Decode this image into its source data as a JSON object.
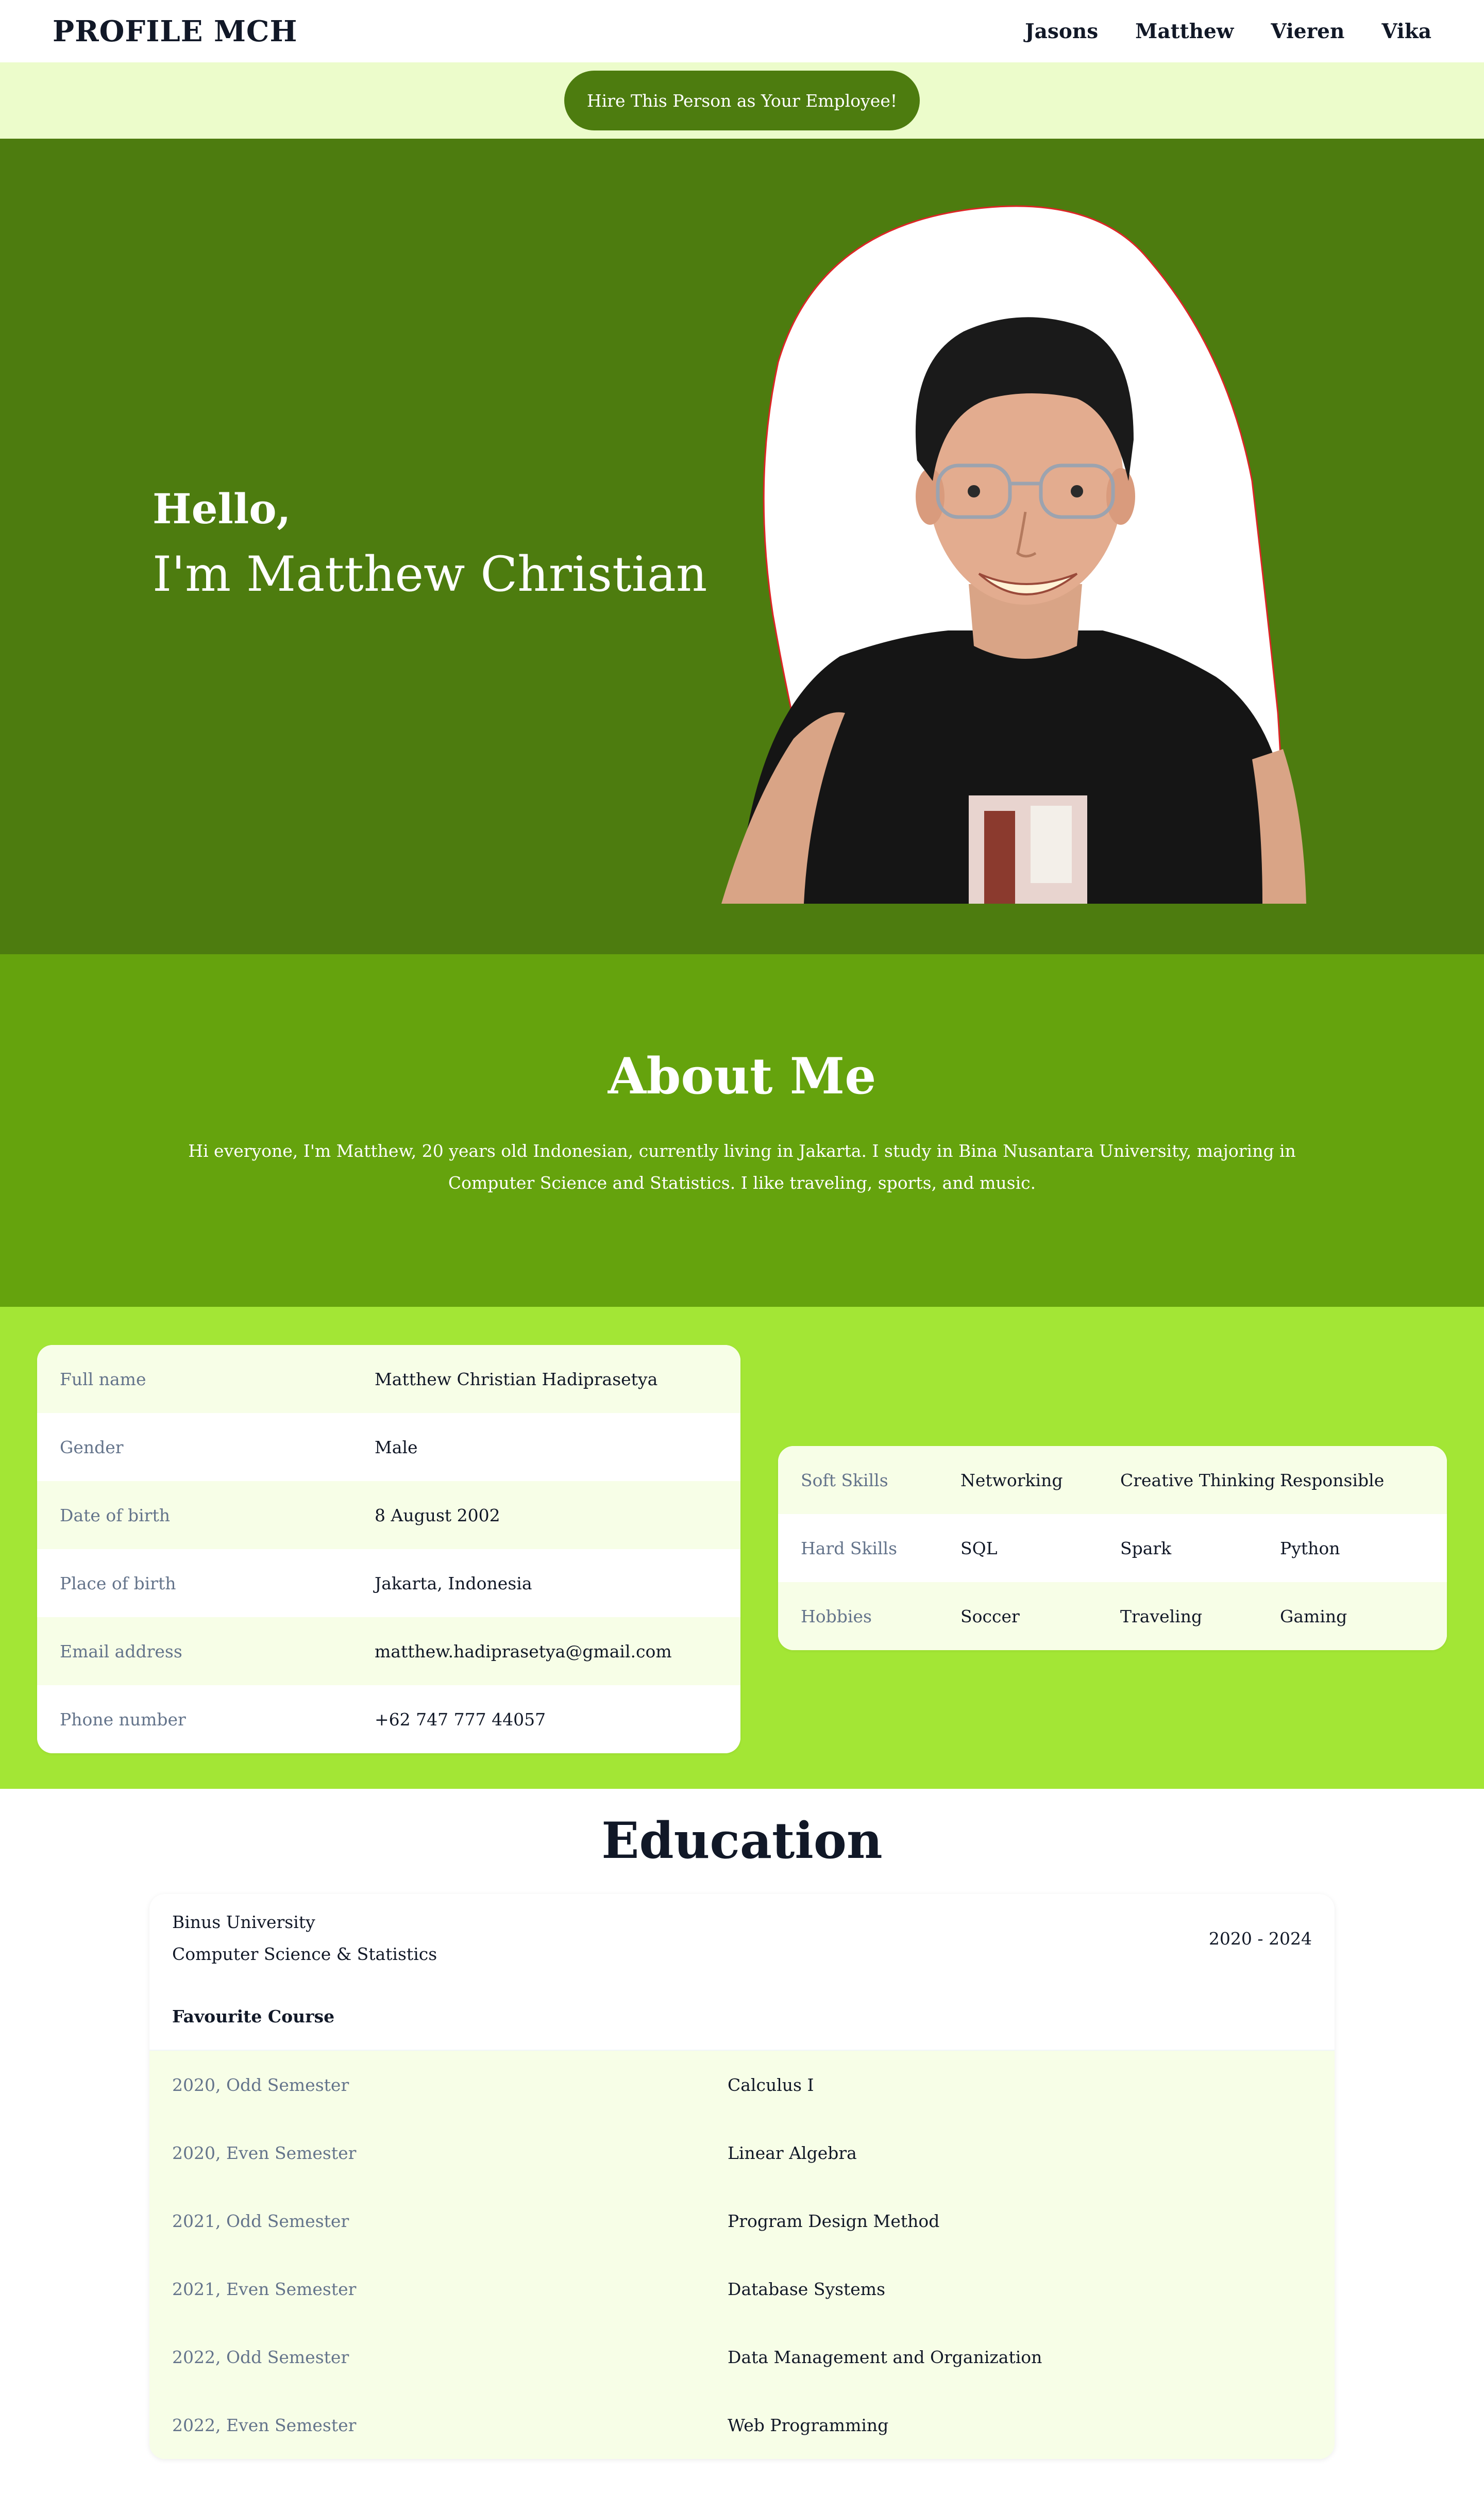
{
  "nav": {
    "brand": "PROFILE MCH",
    "links": [
      "Jasons",
      "Matthew",
      "Vieren",
      "Vika"
    ]
  },
  "hire": {
    "label": "Hire This Person as Your Employee!"
  },
  "hero": {
    "greeting": "Hello,",
    "name": "I'm Matthew Christian"
  },
  "about": {
    "title": "About Me",
    "text": "Hi everyone, I'm Matthew, 20 years old Indonesian, currently living in Jakarta. I study in Bina Nusantara University, majoring in Computer Science and Statistics. I like traveling, sports, and music."
  },
  "personal": [
    {
      "label": "Full name",
      "value": "Matthew Christian Hadiprasetya"
    },
    {
      "label": "Gender",
      "value": "Male"
    },
    {
      "label": "Date of birth",
      "value": "8 August 2002"
    },
    {
      "label": "Place of birth",
      "value": "Jakarta, Indonesia"
    },
    {
      "label": "Email address",
      "value": "matthew.hadiprasetya@gmail.com"
    },
    {
      "label": "Phone number",
      "value": "+62 747 777 44057"
    }
  ],
  "skills": [
    {
      "label": "Soft Skills",
      "items": [
        "Networking",
        "Creative Thinking",
        "Responsible"
      ]
    },
    {
      "label": "Hard Skills",
      "items": [
        "SQL",
        "Spark",
        "Python"
      ]
    },
    {
      "label": "Hobbies",
      "items": [
        "Soccer",
        "Traveling",
        "Gaming"
      ]
    }
  ],
  "education": {
    "title": "Education",
    "school": "Binus University",
    "major": "Computer Science & Statistics",
    "years": "2020 - 2024",
    "favourite_title": "Favourite Course",
    "courses": [
      {
        "semester": "2020, Odd Semester",
        "course": "Calculus I"
      },
      {
        "semester": "2020, Even Semester",
        "course": "Linear Algebra"
      },
      {
        "semester": "2021, Odd Semester",
        "course": "Program Design Method"
      },
      {
        "semester": "2021, Even Semester",
        "course": "Database Systems"
      },
      {
        "semester": "2022, Odd Semester",
        "course": "Data Management and Organization"
      },
      {
        "semester": "2022, Even Semester",
        "course": "Web Programming"
      }
    ]
  },
  "colors": {
    "hero_bg": "#4d7c0f",
    "about_bg": "#65a30d",
    "info_bg": "#a3e635",
    "hire_bar_bg": "#ecfccb",
    "row_tint": "#f7fee7"
  }
}
